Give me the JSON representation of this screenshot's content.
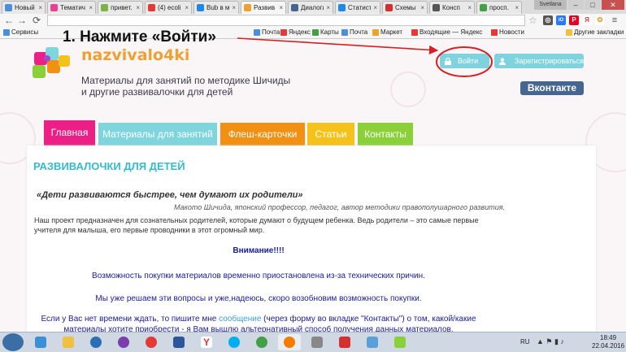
{
  "browser": {
    "tabs": [
      {
        "title": "Новый",
        "color": "#4c8fd6"
      },
      {
        "title": "Тематич",
        "color": "#e84393"
      },
      {
        "title": "привет.",
        "color": "#7cb342"
      },
      {
        "title": "(4) ecoli",
        "color": "#e53935"
      },
      {
        "title": "Bub в мо",
        "color": "#1e88e5"
      },
      {
        "title": "Развив",
        "color": "#f0a030"
      },
      {
        "title": "Диалоги",
        "color": "#45668e"
      },
      {
        "title": "Статист",
        "color": "#1e88e5"
      },
      {
        "title": "Схемы",
        "color": "#d32f2f"
      },
      {
        "title": "Консп",
        "color": "#555555"
      },
      {
        "title": "просп.",
        "color": "#43a047"
      }
    ],
    "active_tab_index": 5,
    "user_badge": "Svetlana",
    "bookmarks": [
      {
        "label": "Сервисы",
        "color": "#4c8fd6"
      },
      {
        "label": "Почта",
        "color": "#4c8fd6"
      },
      {
        "label": "Яндекс",
        "color": "#e53935"
      },
      {
        "label": "Карты",
        "color": "#43a047"
      },
      {
        "label": "Почта",
        "color": "#4c8fd6"
      },
      {
        "label": "Маркет",
        "color": "#f0a030"
      },
      {
        "label": "Входящие — Яндекс",
        "color": "#e53935"
      },
      {
        "label": "Новости",
        "color": "#e53935"
      },
      {
        "label": "Другие закладки",
        "color": "#f0c040"
      }
    ]
  },
  "site": {
    "logo_text": "nazvivalo4ki",
    "tagline_line1": "Материалы для занятий по методике Шичиды",
    "tagline_line2": "и другие развивалочки для детей",
    "login_label": "Войти",
    "register_label": "Зарегистрироваться",
    "vk_label": "Вконтакте",
    "nav": {
      "home": "Главная",
      "materials": "Материалы для занятий",
      "cards": "Флеш-карточки",
      "articles": "Статьи",
      "contacts": "Контакты"
    },
    "content": {
      "title": "РАЗВИВАЛОЧКИ ДЛЯ ДЕТЕЙ",
      "quote": "«Дети развиваются быстрее, чем думают их родители»",
      "quote_author": "Макото Шичида, японский профессор, педагог, автор методики правополушарного развития.",
      "intro": "Наш проект предназначен для сознательных родителей, которые думают о будущем ребенка. Ведь родители – это самые первые учителя для малыша, его первые проводники в этот огромный мир.",
      "attention": "Внимание!!!!",
      "notice1": "Возможность покупки материалов временно приостановлена из-за технических причин.",
      "notice2": "Мы уже решаем эти вопросы и уже,надеюсь, скоро возобновим возможность покупки.",
      "notice3_pre": "Если у Вас нет времени ждать, то пишите мне ",
      "notice3_link": "сообщение",
      "notice3_post": " (через форму во вкладке \"Контакты\") о том, какой/какие",
      "notice3_line2": "материалы хотите приобрести - я Вам вышлю альтернативный способ получения данных материалов."
    }
  },
  "annotation": {
    "text": "1. Нажмите «Войти»",
    "color": "#d62020"
  },
  "taskbar": {
    "lang": "RU",
    "time": "18:49",
    "date": "22.04.2016"
  }
}
